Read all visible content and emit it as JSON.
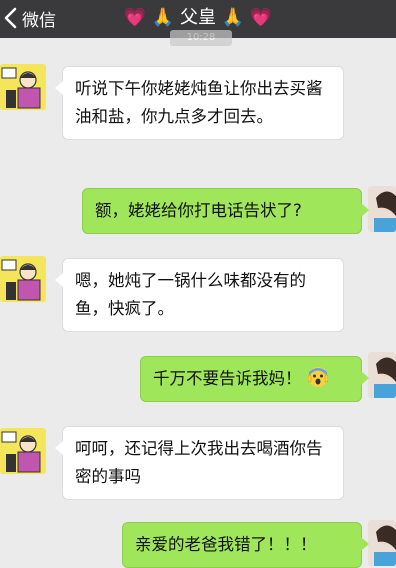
{
  "header": {
    "back_label": "微信",
    "title_left_heart": "💗",
    "title_left_hands": "🙏",
    "title_name": "父皇",
    "title_right_hands": "🙏",
    "title_right_heart": "💗"
  },
  "timestamp": "10:28",
  "messages": [
    {
      "side": "left",
      "text": "听说下午你姥姥炖鱼让你出去买酱油和盐，你九点多才回去。"
    },
    {
      "side": "right",
      "text": "额，姥姥给你打电话告状了?"
    },
    {
      "side": "left",
      "text": "嗯，她炖了一锅什么味都没有的鱼，快疯了。"
    },
    {
      "side": "right",
      "text": "千万不要告诉我妈！"
    },
    {
      "side": "left",
      "text": "呵呵，还记得上次我出去喝酒你告密的事吗"
    },
    {
      "side": "right",
      "text": "亲爱的老爸我错了！！！"
    }
  ]
}
